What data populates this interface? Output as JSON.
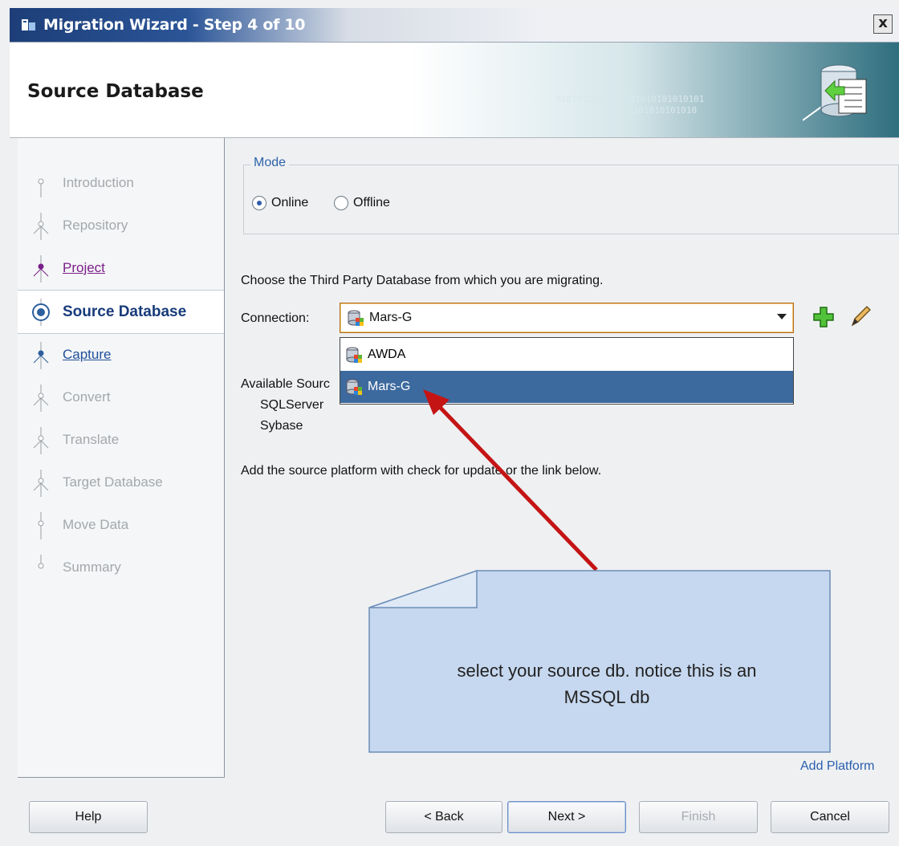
{
  "window": {
    "title": "Migration Wizard - Step 4 of 10",
    "close_glyph": "x"
  },
  "header": {
    "title": "Source Database",
    "binary_art": "0101010101010101010101010101\n     0101010101010"
  },
  "steps": [
    {
      "label": "Introduction",
      "state": "disabled"
    },
    {
      "label": "Repository",
      "state": "disabled"
    },
    {
      "label": "Project",
      "state": "visited"
    },
    {
      "label": "Source Database",
      "state": "current"
    },
    {
      "label": "Capture",
      "state": "link"
    },
    {
      "label": "Convert",
      "state": "disabled"
    },
    {
      "label": "Translate",
      "state": "disabled"
    },
    {
      "label": "Target Database",
      "state": "disabled"
    },
    {
      "label": "Move Data",
      "state": "disabled"
    },
    {
      "label": "Summary",
      "state": "disabled"
    }
  ],
  "mode": {
    "legend": "Mode",
    "online_label": "Online",
    "offline_label": "Offline",
    "selected": "Online"
  },
  "content": {
    "instruction": "Choose the Third Party Database from which you are migrating.",
    "connection_label": "Connection:",
    "connection_value": "Mars-G",
    "available_label": "Available Sourc",
    "platforms": [
      "SQLServer",
      "Sybase"
    ],
    "add_note": "Add the source platform with check for update or the link below.",
    "add_platform_link": "Add Platform"
  },
  "dropdown": {
    "options": [
      "AWDA",
      "Mars-G"
    ],
    "selected": "Mars-G"
  },
  "callout": {
    "text_line1": "select your source db. notice this is an",
    "text_line2": "MSSQL db"
  },
  "buttons": {
    "help": "Help",
    "back": "< Back",
    "next": "Next >",
    "finish": "Finish",
    "cancel": "Cancel"
  },
  "colors": {
    "arrow": "#c41414",
    "callout_fill": "#c6d8ef",
    "selection": "#3d6a9e"
  }
}
